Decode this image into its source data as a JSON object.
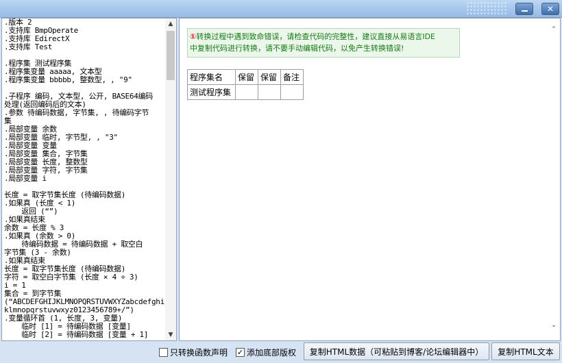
{
  "window": {
    "minimize_glyph": "—",
    "close_glyph": "✕"
  },
  "code_panel": {
    "source": ".版本 2\n.支持库 BmpOperate\n.支持库 EdirectX\n.支持库 Test\n\n.程序集 测试程序集\n.程序集变量 aaaaa, 文本型\n.程序集变量 bbbbb, 整数型, , \"9\"\n\n.子程序 编码, 文本型, 公开, BASE64编码\n处理(返回编码后的文本)\n.参数 待编码数据, 字节集, , 待编码字节\n集\n.局部变量 余数\n.局部变量 临时, 字节型, , \"3\"\n.局部变量 变量\n.局部变量 集合, 字节集\n.局部变量 长度, 整数型\n.局部变量 字符, 字节集\n.局部变量 i\n\n长度 = 取字节集长度 (待编码数据)\n.如果真 (长度 < 1)\n    返回 (“”)\n.如果真结束\n余数 = 长度 % 3\n.如果真 (余数 > 0)\n    待编码数据 = 待编码数据 + 取空白\n字节集 (3 - 余数)\n.如果真结束\n长度 = 取字节集长度 (待编码数据)\n字符 = 取空白字节集 (长度 × 4 ÷ 3)\ni = 1\n集合 = 到字节集\n(“ABCDEFGHIJKLMNOPQRSTUVWXYZabcdefghij\nklmnopqrstuvwxyz0123456789+/”)\n.变量循环首 (1, 长度, 3, 变量)\n    临时 [1] = 待编码数据 [变量]\n    临时 [2] = 待编码数据 [变量 + 1]"
  },
  "preview": {
    "notice_icon": "!",
    "notice_line1": "转换过程中遇到致命错误，请检查代码的完整性，建议直接从易语言IDE",
    "notice_line2": "中复制代码进行转换，请不要手动编辑代码，以免产生转换错误!",
    "table": {
      "headers": [
        "程序集名",
        "保留",
        "保留",
        "备注"
      ],
      "rows": [
        [
          "测试程序集",
          "",
          "",
          ""
        ]
      ]
    }
  },
  "bottom": {
    "checkbox1": {
      "label": "只转换函数声明",
      "checked": false
    },
    "checkbox2": {
      "label": "添加底部版权",
      "checked": true,
      "mark": "✓"
    },
    "copy_html_data": "复制HTML数据（可粘贴到博客/论坛编辑器中）",
    "copy_html_text": "复制HTML文本"
  },
  "colors": {
    "notice_text": "#137a13",
    "notice_icon": "#dd1111",
    "frame_bg": "#d6e3f2"
  }
}
